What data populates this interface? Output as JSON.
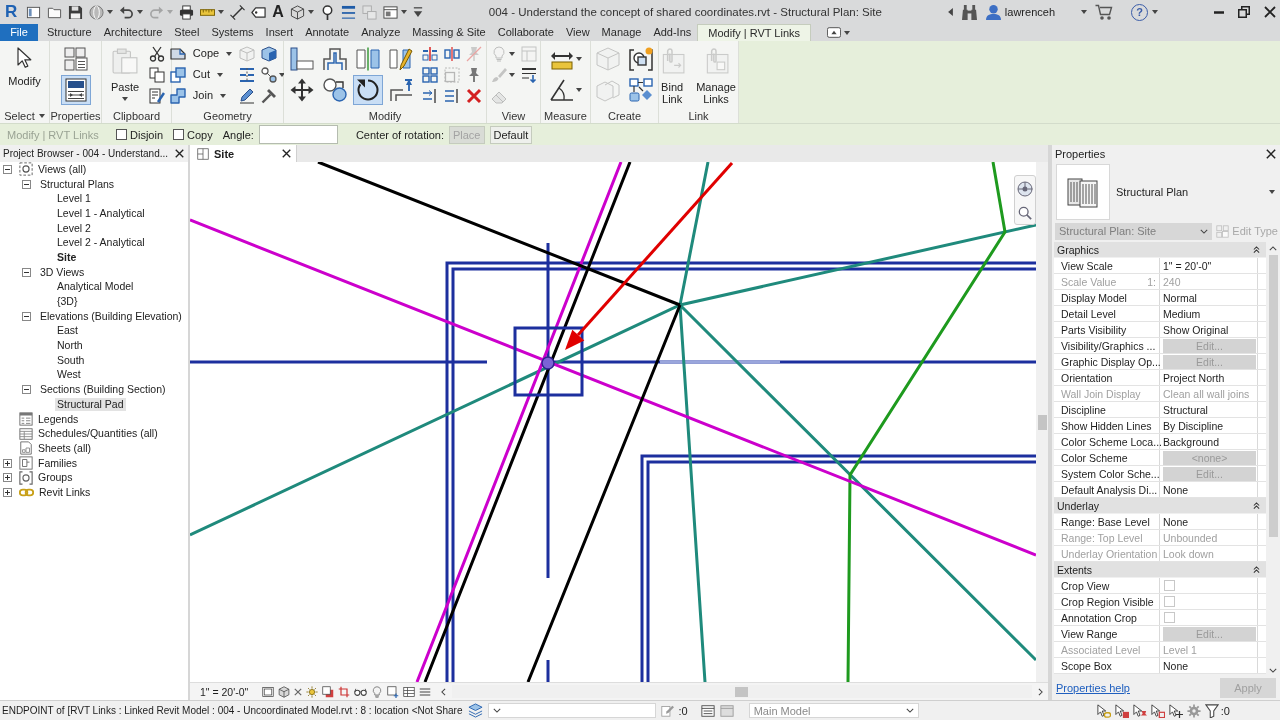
{
  "window": {
    "logo": "R",
    "title": "004 - Understand the concept of shared coordinates.rvt - Structural Plan: Site",
    "user": "lawrenceh",
    "help": "?"
  },
  "quick_access": [
    {
      "disabled": false,
      "dropdown": false
    },
    {
      "disabled": false,
      "dropdown": false
    },
    {
      "disabled": false,
      "dropdown": false
    },
    {
      "disabled": false,
      "dropdown": true
    },
    {
      "disabled": false,
      "dropdown": true
    },
    {
      "disabled": true,
      "dropdown": true
    },
    {
      "disabled": false,
      "dropdown": false
    },
    {
      "disabled": false,
      "dropdown": true
    },
    {
      "disabled": false,
      "dropdown": false
    },
    {
      "disabled": false,
      "dropdown": false
    },
    {
      "label": "A",
      "disabled": false,
      "dropdown": false
    },
    {
      "disabled": false,
      "dropdown": true
    },
    {
      "disabled": false,
      "dropdown": false
    },
    {
      "disabled": false,
      "dropdown": false
    },
    {
      "disabled": true,
      "dropdown": false
    },
    {
      "disabled": false,
      "dropdown": true
    },
    {
      "disabled": false,
      "dropdown": false
    }
  ],
  "ribbon_tabs": [
    {
      "label": "File",
      "kind": "file",
      "selected": false
    },
    {
      "label": "Structure",
      "kind": "tab",
      "selected": false
    },
    {
      "label": "Architecture",
      "kind": "tab",
      "selected": false
    },
    {
      "label": "Steel",
      "kind": "tab",
      "selected": false
    },
    {
      "label": "Systems",
      "kind": "tab",
      "selected": false
    },
    {
      "label": "Insert",
      "kind": "tab",
      "selected": false
    },
    {
      "label": "Annotate",
      "kind": "tab",
      "selected": false
    },
    {
      "label": "Analyze",
      "kind": "tab",
      "selected": false
    },
    {
      "label": "Massing & Site",
      "kind": "tab",
      "selected": false
    },
    {
      "label": "Collaborate",
      "kind": "tab",
      "selected": false
    },
    {
      "label": "View",
      "kind": "tab",
      "selected": false
    },
    {
      "label": "Manage",
      "kind": "tab",
      "selected": false
    },
    {
      "label": "Add-Ins",
      "kind": "tab",
      "selected": false
    },
    {
      "label": "Modify | RVT Links",
      "kind": "contextual",
      "selected": true
    }
  ],
  "ribbon_panels": [
    {
      "label": "Select",
      "dropdown": true,
      "tools": [
        {
          "kind": "large",
          "label": "Modify",
          "disabled": false,
          "active": false,
          "dropdown": false
        }
      ]
    },
    {
      "label": "Properties",
      "dropdown": false,
      "tools": [
        {
          "kind": "medium",
          "disabled": false,
          "active": false,
          "dropdown": false
        },
        {
          "kind": "medium",
          "disabled": false,
          "active": true,
          "dropdown": false
        }
      ]
    },
    {
      "label": "Clipboard",
      "dropdown": false,
      "tools": [
        {
          "kind": "large",
          "label": "Paste",
          "disabled": true,
          "active": false,
          "dropdown": true
        },
        {
          "kind": "small",
          "disabled": false,
          "active": false,
          "dropdown": false
        },
        {
          "kind": "small",
          "disabled": false,
          "active": false,
          "dropdown": false
        },
        {
          "kind": "small",
          "disabled": false,
          "active": false,
          "dropdown": false
        }
      ]
    },
    {
      "label": "Geometry",
      "dropdown": false,
      "tools": [
        {
          "kind": "row",
          "label": "Cope",
          "disabled": false,
          "active": false,
          "dropdown": true
        },
        {
          "kind": "row",
          "label": "Cut",
          "disabled": false,
          "active": false,
          "dropdown": true
        },
        {
          "kind": "row",
          "label": "Join",
          "disabled": false,
          "active": false,
          "dropdown": true
        },
        {
          "kind": "small",
          "disabled": true,
          "active": false,
          "dropdown": false
        },
        {
          "kind": "small",
          "disabled": false,
          "active": false,
          "dropdown": false
        },
        {
          "kind": "small",
          "disabled": false,
          "active": false,
          "dropdown": false
        },
        {
          "kind": "small",
          "disabled": false,
          "active": false,
          "dropdown": false
        },
        {
          "kind": "small",
          "disabled": false,
          "active": false,
          "dropdown": true
        },
        {
          "kind": "small",
          "disabled": false,
          "active": false,
          "dropdown": false
        }
      ]
    },
    {
      "label": "Modify",
      "dropdown": false,
      "tools": [
        {
          "kind": "medium",
          "disabled": false,
          "active": false,
          "dropdown": false
        },
        {
          "kind": "medium",
          "disabled": false,
          "active": false,
          "dropdown": false
        },
        {
          "kind": "medium",
          "disabled": false,
          "active": false,
          "dropdown": false
        },
        {
          "kind": "medium",
          "disabled": false,
          "active": false,
          "dropdown": false
        },
        {
          "kind": "medium",
          "disabled": false,
          "active": false,
          "dropdown": false
        },
        {
          "kind": "medium",
          "disabled": false,
          "active": true,
          "dropdown": false
        },
        {
          "kind": "medium",
          "disabled": false,
          "active": false,
          "dropdown": false
        },
        {
          "kind": "medium",
          "disabled": false,
          "active": false,
          "dropdown": false
        },
        {
          "kind": "small",
          "disabled": false,
          "active": false,
          "dropdown": false
        },
        {
          "kind": "small",
          "disabled": false,
          "active": false,
          "dropdown": false
        },
        {
          "kind": "small",
          "disabled": false,
          "active": false,
          "dropdown": false
        },
        {
          "kind": "small",
          "disabled": false,
          "active": false,
          "dropdown": false
        },
        {
          "kind": "small",
          "disabled": true,
          "active": false,
          "dropdown": false
        },
        {
          "kind": "small",
          "disabled": false,
          "active": false,
          "dropdown": false
        },
        {
          "kind": "small",
          "disabled": true,
          "active": false,
          "dropdown": false
        },
        {
          "kind": "small",
          "disabled": false,
          "active": false,
          "dropdown": false
        },
        {
          "kind": "small",
          "disabled": false,
          "active": false,
          "dropdown": false
        }
      ]
    },
    {
      "label": "View",
      "dropdown": false,
      "tools": [
        {
          "kind": "small",
          "disabled": true,
          "active": false,
          "dropdown": true
        },
        {
          "kind": "small",
          "disabled": true,
          "active": false,
          "dropdown": true
        },
        {
          "kind": "small",
          "disabled": true,
          "active": false,
          "dropdown": false
        },
        {
          "kind": "small",
          "disabled": true,
          "active": false,
          "dropdown": false
        },
        {
          "kind": "small",
          "disabled": false,
          "active": false,
          "dropdown": false
        }
      ]
    },
    {
      "label": "Measure",
      "dropdown": false,
      "tools": [
        {
          "kind": "medium",
          "disabled": false,
          "active": false,
          "dropdown": true
        },
        {
          "kind": "medium",
          "disabled": false,
          "active": false,
          "dropdown": true
        }
      ]
    },
    {
      "label": "Create",
      "dropdown": false,
      "tools": [
        {
          "kind": "medium",
          "disabled": true,
          "active": false,
          "dropdown": false
        },
        {
          "kind": "medium",
          "disabled": true,
          "active": false,
          "dropdown": false
        },
        {
          "kind": "medium",
          "disabled": false,
          "active": false,
          "dropdown": false
        },
        {
          "kind": "medium",
          "disabled": false,
          "active": false,
          "dropdown": false
        }
      ]
    },
    {
      "label": "Link",
      "dropdown": false,
      "tools": [
        {
          "kind": "large",
          "label": "Bind Link",
          "disabled": true,
          "active": false,
          "dropdown": false
        },
        {
          "kind": "large",
          "label": "Manage Links",
          "disabled": true,
          "active": false,
          "dropdown": false
        }
      ]
    }
  ],
  "options_bar": {
    "context": "Modify | RVT Links",
    "checkboxes": [
      {
        "label": "Disjoin",
        "checked": false
      },
      {
        "label": "Copy",
        "checked": false
      }
    ],
    "angle_label": "Angle:",
    "rotation_label": "Center of rotation:",
    "buttons": [
      {
        "label": "Place",
        "disabled": true
      },
      {
        "label": "Default",
        "disabled": false
      }
    ]
  },
  "project_browser": {
    "title": "Project Browser - 004 - Understand...",
    "tree": [
      {
        "label": "Views (all)",
        "kind": "views",
        "expanded": true,
        "selected": false,
        "current": false,
        "children": [
          {
            "label": "Structural Plans",
            "expanded": true,
            "selected": false,
            "current": false,
            "children": [
              {
                "label": "Level 1",
                "selected": false,
                "current": false
              },
              {
                "label": "Level 1 - Analytical",
                "selected": false,
                "current": false
              },
              {
                "label": "Level 2",
                "selected": false,
                "current": false
              },
              {
                "label": "Level 2 - Analytical",
                "selected": false,
                "current": false
              },
              {
                "label": "Site",
                "selected": false,
                "current": true
              }
            ]
          },
          {
            "label": "3D Views",
            "expanded": true,
            "selected": false,
            "current": false,
            "children": [
              {
                "label": "Analytical Model",
                "selected": false,
                "current": false
              },
              {
                "label": "{3D}",
                "selected": false,
                "current": false
              }
            ]
          },
          {
            "label": "Elevations (Building Elevation)",
            "expanded": true,
            "selected": false,
            "current": false,
            "children": [
              {
                "label": "East",
                "selected": false,
                "current": false
              },
              {
                "label": "North",
                "selected": false,
                "current": false
              },
              {
                "label": "South",
                "selected": false,
                "current": false
              },
              {
                "label": "West",
                "selected": false,
                "current": false
              }
            ]
          },
          {
            "label": "Sections (Building Section)",
            "expanded": true,
            "selected": false,
            "current": false,
            "children": [
              {
                "label": "Structural Pad",
                "selected": true,
                "current": false
              }
            ]
          }
        ]
      },
      {
        "label": "Legends",
        "kind": "legends",
        "selected": false,
        "current": false
      },
      {
        "label": "Schedules/Quantities (all)",
        "kind": "schedules",
        "selected": false,
        "current": false
      },
      {
        "label": "Sheets (all)",
        "kind": "sheets",
        "selected": false,
        "current": false
      },
      {
        "label": "Families",
        "kind": "families",
        "expanded": false,
        "selected": false,
        "current": false
      },
      {
        "label": "Groups",
        "kind": "groups",
        "expanded": false,
        "selected": false,
        "current": false
      },
      {
        "label": "Revit Links",
        "kind": "links",
        "expanded": false,
        "selected": false,
        "current": false
      }
    ]
  },
  "view": {
    "tab": "Site",
    "scale": "1\" = 20'-0\""
  },
  "properties": {
    "title": "Properties",
    "type_name": "Structural Plan",
    "instance": "Structural Plan: Site",
    "edit_type": {
      "label": "Edit Type",
      "disabled": true
    },
    "groups": [
      {
        "label": "Graphics",
        "expanded": true,
        "rows": [
          {
            "name": "View Scale",
            "value": "1\" = 20'-0\"",
            "kind": "text",
            "disabled": false
          },
          {
            "name": "Scale Value",
            "suffix": "1:",
            "value": "240",
            "kind": "text",
            "disabled": true
          },
          {
            "name": "Display Model",
            "value": "Normal",
            "kind": "text",
            "disabled": false
          },
          {
            "name": "Detail Level",
            "value": "Medium",
            "kind": "text",
            "disabled": false
          },
          {
            "name": "Parts Visibility",
            "value": "Show Original",
            "kind": "text",
            "disabled": false
          },
          {
            "name": "Visibility/Graphics ...",
            "value": "Edit...",
            "kind": "button",
            "disabled": false
          },
          {
            "name": "Graphic Display Op...",
            "value": "Edit...",
            "kind": "button",
            "disabled": false
          },
          {
            "name": "Orientation",
            "value": "Project North",
            "kind": "text",
            "disabled": false
          },
          {
            "name": "Wall Join Display",
            "value": "Clean all wall joins",
            "kind": "text",
            "disabled": true
          },
          {
            "name": "Discipline",
            "value": "Structural",
            "kind": "text",
            "disabled": false
          },
          {
            "name": "Show Hidden Lines",
            "value": "By Discipline",
            "kind": "text",
            "disabled": false
          },
          {
            "name": "Color Scheme Loca...",
            "value": "Background",
            "kind": "text",
            "disabled": false
          },
          {
            "name": "Color Scheme",
            "value": "<none>",
            "kind": "button",
            "disabled": false
          },
          {
            "name": "System Color Sche...",
            "value": "Edit...",
            "kind": "button",
            "disabled": false
          },
          {
            "name": "Default Analysis Di...",
            "value": "None",
            "kind": "text",
            "disabled": false
          }
        ]
      },
      {
        "label": "Underlay",
        "expanded": true,
        "rows": [
          {
            "name": "Range: Base Level",
            "value": "None",
            "kind": "text",
            "disabled": false
          },
          {
            "name": "Range: Top Level",
            "value": "Unbounded",
            "kind": "text",
            "disabled": true
          },
          {
            "name": "Underlay Orientation",
            "value": "Look down",
            "kind": "text",
            "disabled": true
          }
        ]
      },
      {
        "label": "Extents",
        "expanded": true,
        "rows": [
          {
            "name": "Crop View",
            "kind": "checkbox",
            "checked": false,
            "disabled": false
          },
          {
            "name": "Crop Region Visible",
            "kind": "checkbox",
            "checked": false,
            "disabled": false
          },
          {
            "name": "Annotation Crop",
            "kind": "checkbox",
            "checked": false,
            "disabled": false
          },
          {
            "name": "View Range",
            "value": "Edit...",
            "kind": "button",
            "disabled": false
          },
          {
            "name": "Associated Level",
            "value": "Level 1",
            "kind": "text",
            "disabled": true
          },
          {
            "name": "Scope Box",
            "value": "None",
            "kind": "text",
            "disabled": false
          }
        ]
      }
    ],
    "help": "Properties help",
    "apply": {
      "label": "Apply",
      "disabled": true
    }
  },
  "status_bar": {
    "text": "ENDPOINT of [RVT Links : Linked Revit Model : 004 - Uncoordinated Model.rvt : 8 : location <Not Share",
    "editable_count": ":0",
    "design_option": "Main Model",
    "filter_count": ":0"
  }
}
